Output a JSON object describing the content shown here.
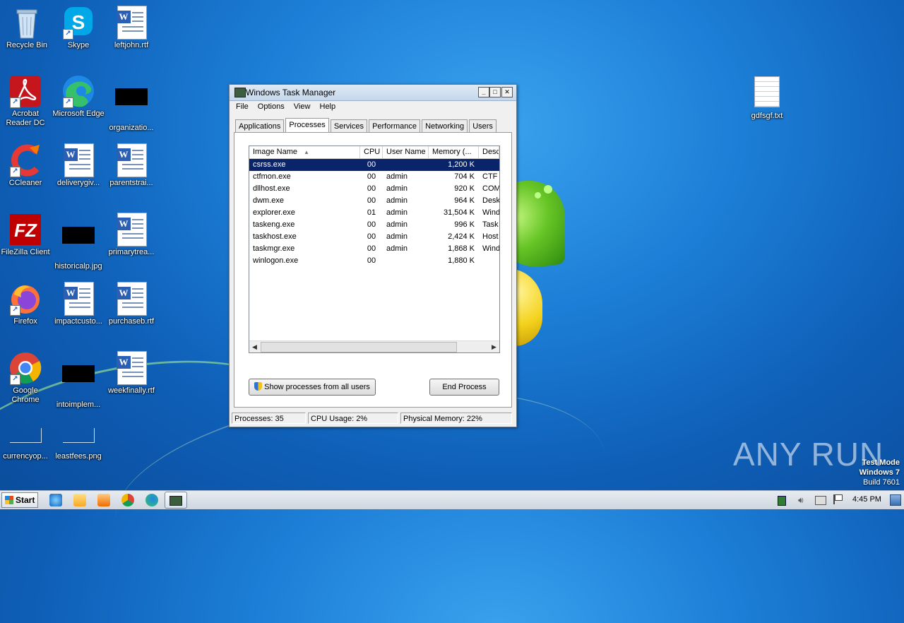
{
  "desktop": {
    "icons": [
      {
        "label": "Recycle Bin"
      },
      {
        "label": "Skype"
      },
      {
        "label": "leftjohn.rtf"
      },
      {
        "label": "Acrobat Reader DC"
      },
      {
        "label": "Microsoft Edge"
      },
      {
        "label": "organizatio..."
      },
      {
        "label": "CCleaner"
      },
      {
        "label": "deliverygiv..."
      },
      {
        "label": "parentstrai..."
      },
      {
        "label": "FileZilla Client"
      },
      {
        "label": "historicalp.jpg"
      },
      {
        "label": "primarytrea..."
      },
      {
        "label": "Firefox"
      },
      {
        "label": "impactcusto..."
      },
      {
        "label": "purchaseb.rtf"
      },
      {
        "label": "Google Chrome"
      },
      {
        "label": "intoimplem..."
      },
      {
        "label": "weekfinally.rtf"
      },
      {
        "label": "currencyop..."
      },
      {
        "label": "leastfees.png"
      },
      {
        "label": "gdfsgf.txt"
      }
    ]
  },
  "window": {
    "title": "Windows Task Manager",
    "controls": {
      "minimize": "_",
      "maximize": "□",
      "close": "✕"
    },
    "menu": [
      "File",
      "Options",
      "View",
      "Help"
    ],
    "tabs": [
      "Applications",
      "Processes",
      "Services",
      "Performance",
      "Networking",
      "Users"
    ],
    "active_tab": "Processes",
    "columns": [
      "Image Name",
      "CPU",
      "User Name",
      "Memory (...",
      "Desc"
    ],
    "sort_indicator": "▲",
    "rows": [
      {
        "name": "csrss.exe",
        "cpu": "00",
        "user": "",
        "mem": "1,200 K",
        "desc": ""
      },
      {
        "name": "ctfmon.exe",
        "cpu": "00",
        "user": "admin",
        "mem": "704 K",
        "desc": "CTF I"
      },
      {
        "name": "dllhost.exe",
        "cpu": "00",
        "user": "admin",
        "mem": "920 K",
        "desc": "COM"
      },
      {
        "name": "dwm.exe",
        "cpu": "00",
        "user": "admin",
        "mem": "964 K",
        "desc": "Desk"
      },
      {
        "name": "explorer.exe",
        "cpu": "01",
        "user": "admin",
        "mem": "31,504 K",
        "desc": "Wind"
      },
      {
        "name": "taskeng.exe",
        "cpu": "00",
        "user": "admin",
        "mem": "996 K",
        "desc": "Task"
      },
      {
        "name": "taskhost.exe",
        "cpu": "00",
        "user": "admin",
        "mem": "2,424 K",
        "desc": "Host"
      },
      {
        "name": "taskmgr.exe",
        "cpu": "00",
        "user": "admin",
        "mem": "1,868 K",
        "desc": "Wind"
      },
      {
        "name": "winlogon.exe",
        "cpu": "00",
        "user": "",
        "mem": "1,880 K",
        "desc": ""
      }
    ],
    "show_all_button": "Show processes from all users",
    "end_process_button": "End Process",
    "status": {
      "processes": "Processes: 35",
      "cpu": "CPU Usage: 2%",
      "memory": "Physical Memory: 22%"
    }
  },
  "taskbar": {
    "start_label": "Start",
    "clock": "4:45 PM"
  },
  "overlay": {
    "watermark": "ANY RUN",
    "test_mode": "Test Mode",
    "os": "Windows 7",
    "build": "Build 7601"
  }
}
